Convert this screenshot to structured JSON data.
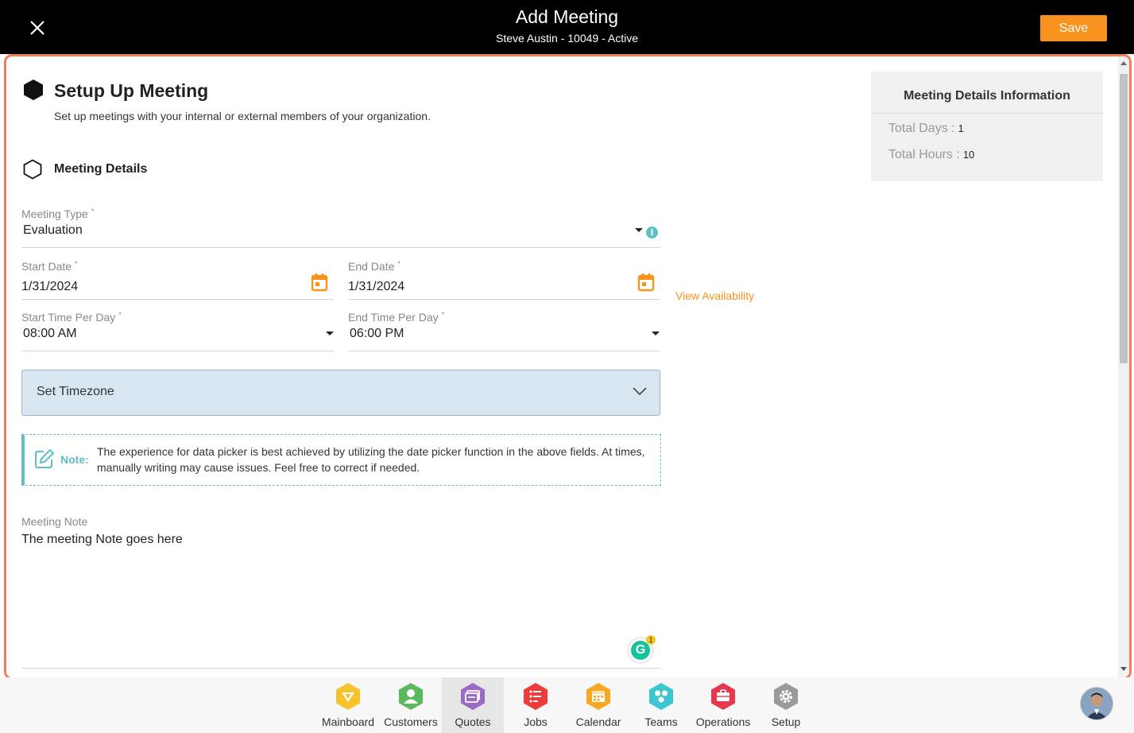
{
  "header": {
    "title": "Add Meeting",
    "subtitle": "Steve Austin - 10049 - Active",
    "save_label": "Save"
  },
  "setup": {
    "title": "Setup Up Meeting",
    "description": "Set up meetings with your internal or external members of your organization."
  },
  "section": {
    "title": "Meeting Details"
  },
  "form": {
    "meeting_type": {
      "label": "Meeting Type",
      "value": "Evaluation"
    },
    "start_date": {
      "label": "Start Date",
      "value": "1/31/2024"
    },
    "end_date": {
      "label": "End Date",
      "value": "1/31/2024"
    },
    "view_availability": "View Availability",
    "start_time": {
      "label": "Start Time Per Day",
      "value": "08:00 AM"
    },
    "end_time": {
      "label": "End Time Per Day",
      "value": "06:00 PM"
    },
    "required_mark": "*",
    "timezone_label": "Set Timezone",
    "note": {
      "label": "Note:",
      "text": "The experience for data picker is best achieved by utilizing the date picker function in the above fields. At times, manually writing may cause issues. Feel free to correct if needed."
    },
    "meeting_note": {
      "label": "Meeting Note",
      "value": "The meeting Note goes here"
    }
  },
  "grammarly": {
    "letter": "G",
    "count": "1"
  },
  "info_panel": {
    "title": "Meeting Details Information",
    "total_days_label": "Total Days :",
    "total_days": "1",
    "total_hours_label": "Total Hours :",
    "total_hours": "10"
  },
  "nav": {
    "active": "Quotes",
    "items": [
      {
        "label": "Mainboard",
        "color": "#f7c22a"
      },
      {
        "label": "Customers",
        "color": "#5cb85c"
      },
      {
        "label": "Quotes",
        "color": "#9b6bc4"
      },
      {
        "label": "Jobs",
        "color": "#ee3a3a"
      },
      {
        "label": "Calendar",
        "color": "#f7a823"
      },
      {
        "label": "Teams",
        "color": "#3cc6cf"
      },
      {
        "label": "Operations",
        "color": "#e8384f"
      },
      {
        "label": "Setup",
        "color": "#9a9a9a"
      }
    ]
  },
  "colors": {
    "accent": "#f7931e",
    "frame": "#f07e59",
    "info": "#5bc0c8"
  }
}
